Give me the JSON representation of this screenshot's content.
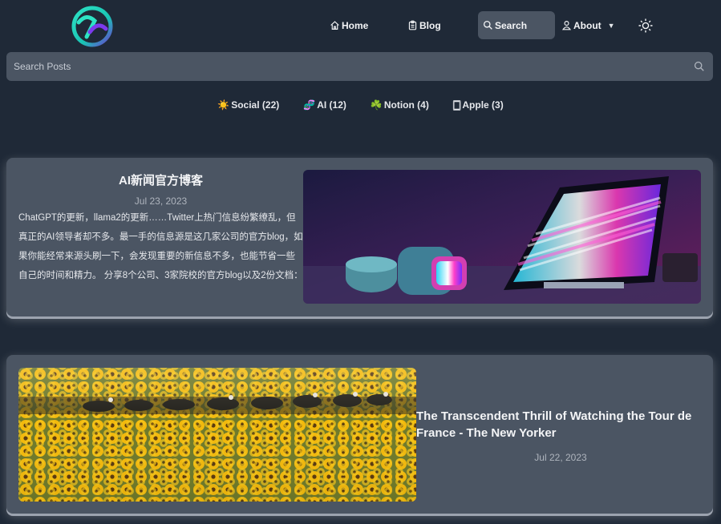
{
  "header": {
    "logo_icon": "site-logo-icon",
    "nav": {
      "home": "Home",
      "blog": "Blog",
      "search": "Search",
      "about": "About"
    },
    "theme_toggle_icon": "sun-icon"
  },
  "search": {
    "placeholder": "Search Posts",
    "value": ""
  },
  "categories": [
    {
      "emoji": "☀️",
      "label": "Social (22)"
    },
    {
      "emoji": "🧬",
      "label": "AI (12)"
    },
    {
      "emoji": "☘️",
      "label": "Notion (4)"
    },
    {
      "emoji": "🀆",
      "label": "Apple (3)"
    }
  ],
  "posts": [
    {
      "title": "AI新闻官方博客",
      "date": "Jul 23, 2023",
      "excerpt": "ChatGPT的更新，llama2的更新……Twitter上热门信息纷繁缭乱，但真正的AI领导者却不多。最一手的信息源是这几家公司的官方blog，如果你能经常来源头刷一下，会发现重要的新信息不多，也能节省一些自己的时间和精力。 分享8个公司、3家院校的官方blog以及2份文档：",
      "image": "desktop-computer-neon-image"
    },
    {
      "title": "The Transcendent Thrill of Watching the Tour de France - The New Yorker",
      "date": "Jul 22, 2023",
      "image": "sunflower-field-cyclists-image"
    }
  ],
  "colors": {
    "background": "#1f2937",
    "card": "#4b5563",
    "nav_active": "#4b5563"
  }
}
